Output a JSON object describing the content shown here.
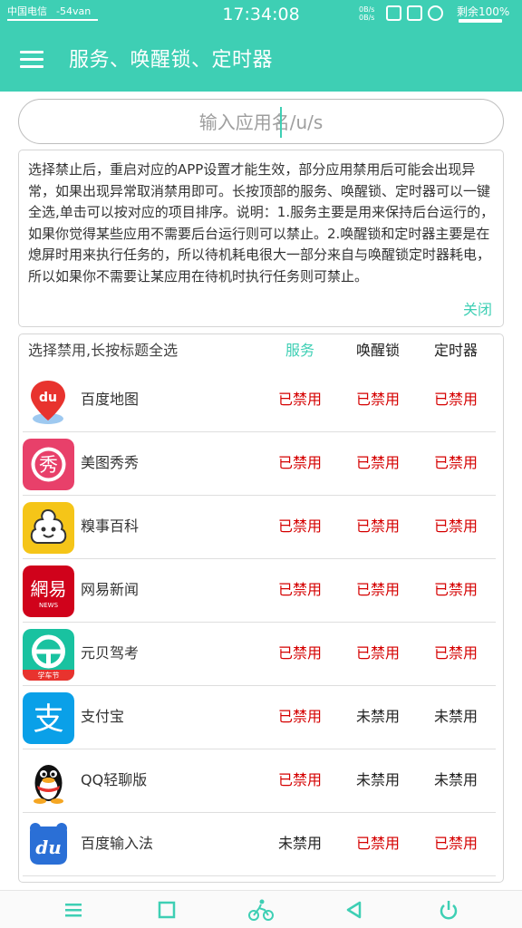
{
  "status_bar": {
    "carrier": "中国电信",
    "signal": "-54van",
    "time": "17:34:08",
    "net_speed_up": "0B/s",
    "net_speed_down": "0B/s",
    "battery": "剩余100%"
  },
  "app_bar": {
    "menu_icon": "hamburger-menu-icon",
    "title": "服务、唤醒锁、定时器"
  },
  "search": {
    "placeholder": "输入应用名/u/s"
  },
  "info": {
    "text": "选择禁止后，重启对应的APP设置才能生效，部分应用禁用后可能会出现异常，如果出现异常取消禁用即可。长按顶部的服务、唤醒锁、定时器可以一键全选,单击可以按对应的项目排序。说明：1.服务主要是用来保持后台运行的，如果你觉得某些应用不需要后台运行则可以禁止。2.唤醒锁和定时器主要是在熄屏时用来执行任务的，所以待机耗电很大一部分来自与唤醒锁定时器耗电，所以如果你不需要让某应用在待机时执行任务则可禁止。",
    "close_label": "关闭"
  },
  "list": {
    "hint": "选择禁用,长按标题全选",
    "columns": [
      "服务",
      "唤醒锁",
      "定时器"
    ],
    "active_column": 0,
    "apps": [
      {
        "name": "百度地图",
        "icon": "baidu-map-icon",
        "service": "已禁用",
        "wakelock": "已禁用",
        "timer": "已禁用"
      },
      {
        "name": "美图秀秀",
        "icon": "meitu-icon",
        "service": "已禁用",
        "wakelock": "已禁用",
        "timer": "已禁用"
      },
      {
        "name": "糗事百科",
        "icon": "qiushibaike-icon",
        "service": "已禁用",
        "wakelock": "已禁用",
        "timer": "已禁用"
      },
      {
        "name": "网易新闻",
        "icon": "netease-news-icon",
        "service": "已禁用",
        "wakelock": "已禁用",
        "timer": "已禁用"
      },
      {
        "name": "元贝驾考",
        "icon": "yuanbei-jiakao-icon",
        "service": "已禁用",
        "wakelock": "已禁用",
        "timer": "已禁用"
      },
      {
        "name": "支付宝",
        "icon": "alipay-icon",
        "service": "已禁用",
        "wakelock": "未禁用",
        "timer": "未禁用"
      },
      {
        "name": "QQ轻聊版",
        "icon": "qq-lite-icon",
        "service": "已禁用",
        "wakelock": "未禁用",
        "timer": "未禁用"
      },
      {
        "name": "百度输入法",
        "icon": "baidu-input-icon",
        "service": "未禁用",
        "wakelock": "已禁用",
        "timer": "已禁用"
      }
    ]
  },
  "icon_text": {
    "baidu_map": "du",
    "meitu": "秀",
    "netease": "網易",
    "netease_sub": "NEWS",
    "yuanbei": "学车节",
    "alipay": "支",
    "baidu_input": "du"
  },
  "colors": {
    "accent": "#3ecfb4",
    "banned": "#d50000",
    "allowed": "#222222"
  },
  "nav_bar": [
    "menu-icon",
    "square-icon",
    "cyclist-icon",
    "back-triangle-icon",
    "power-icon"
  ]
}
